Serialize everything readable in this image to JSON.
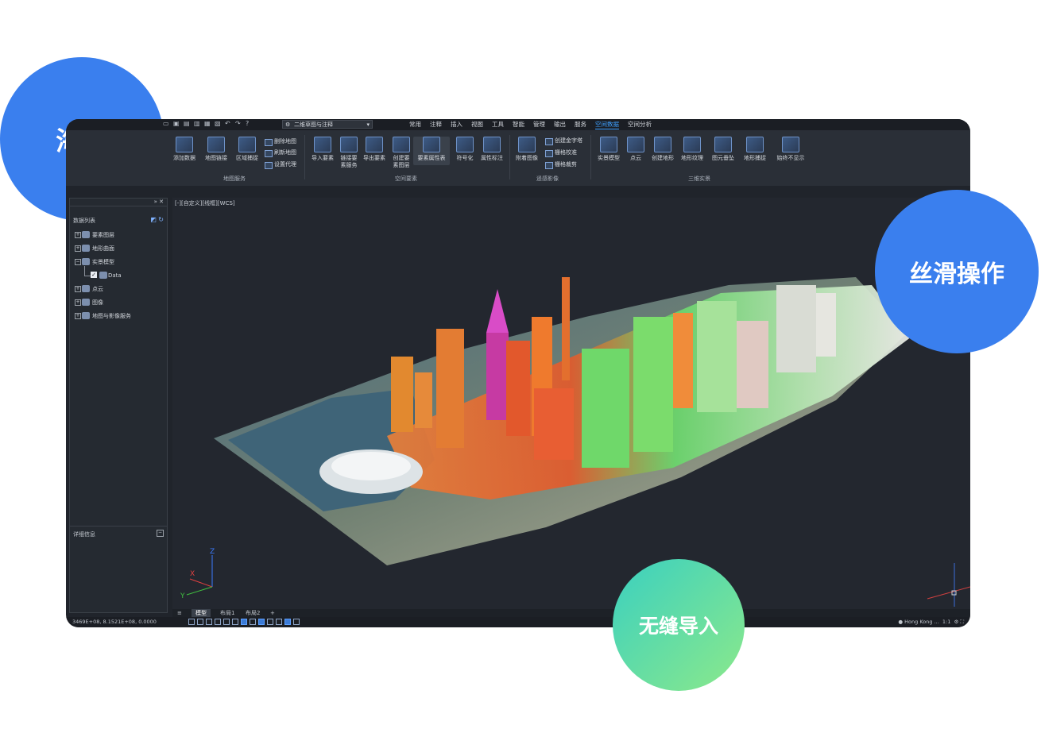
{
  "bubbles": {
    "left": "海量",
    "right": "丝滑操作",
    "bottom": "无缝导入"
  },
  "workspace": "二维草图与注释",
  "menus": [
    "常用",
    "注释",
    "插入",
    "视图",
    "工具",
    "智能",
    "管理",
    "输出",
    "服务",
    "空间数据",
    "空间分析"
  ],
  "active_menu": "空间数据",
  "ribbon": {
    "map_service": {
      "add_data": "添加数据",
      "map_link": "地图链接",
      "region_capture": "区域捕捉",
      "delete_map": "删除地图",
      "refresh_map": "刷新地图",
      "set_proxy": "设置代理",
      "group": "地图服务"
    },
    "spatial_features": {
      "import_feature": "导入要素",
      "link_feature_service_1": "链接要",
      "link_feature_service_2": "素服务",
      "export_feature": "导出要素",
      "create_layer_1": "创建要",
      "create_layer_2": "素图层",
      "attribute_table": "要素属性表",
      "symbolize": "符号化",
      "attribute_label": "属性标注",
      "group": "空间要素"
    },
    "remote_sensing": {
      "attach_image": "附着图像",
      "create_pyramid": "创建金字塔",
      "raster_correction": "栅格校准",
      "raster_clip": "栅格裁剪",
      "group": "遥感影像"
    },
    "reality_3d": {
      "reality_model": "实景模型",
      "point_cloud": "点云",
      "create_terrain": "创建地形",
      "terrain_texture": "地形纹理",
      "primitive_flatten": "图元垂坠",
      "terrain_capture": "地形捕捉",
      "always_hide": "始终不显示",
      "group": "三维实景"
    }
  },
  "left_panel": {
    "list_title": "数据列表",
    "tree": [
      {
        "label": "要素图层"
      },
      {
        "label": "地形曲面"
      },
      {
        "label": "实景模型"
      },
      {
        "label": "Data",
        "child": true
      },
      {
        "label": "点云"
      },
      {
        "label": "图像"
      },
      {
        "label": "地图与影像服务"
      }
    ],
    "detail_title": "详细信息"
  },
  "viewport": {
    "label": "[-][自定义][线框][WCS]"
  },
  "tabs": [
    "模型",
    "布局1",
    "布局2",
    "+"
  ],
  "status": {
    "coords": "3469E+08, 8.1521E+08, 0.0000",
    "location": "Hong Kong ...",
    "scale": "1:1"
  },
  "axes": {
    "x": "X",
    "y": "Y",
    "z": "Z"
  }
}
